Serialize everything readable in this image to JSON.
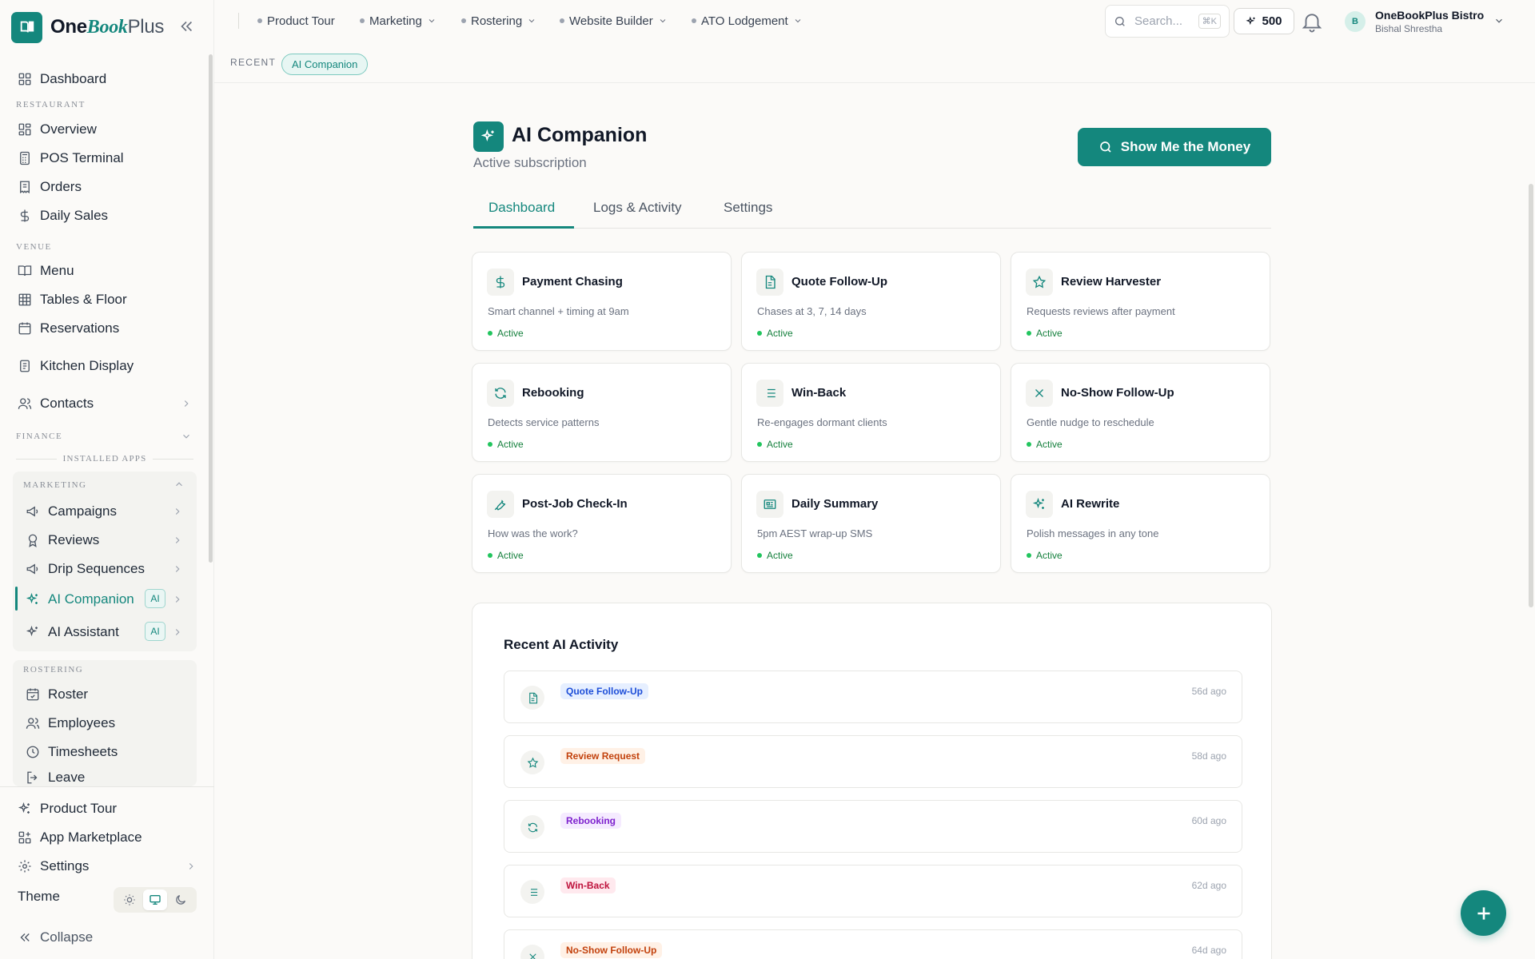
{
  "brand": {
    "name_1": "One",
    "name_2": "Book",
    "name_3": "Plus",
    "collapse_icon": "double-chevron-left-icon"
  },
  "sidebar": {
    "dashboard": "Dashboard",
    "restaurant_label": "RESTAURANT",
    "restaurant": [
      "Overview",
      "POS Terminal",
      "Orders",
      "Daily Sales"
    ],
    "venue_label": "VENUE",
    "venue": [
      "Menu",
      "Tables & Floor",
      "Reservations"
    ],
    "kitchen": "Kitchen Display",
    "contacts": "Contacts",
    "finance_label": "FINANCE",
    "installed_label": "INSTALLED APPS",
    "marketing_label": "MARKETING",
    "marketing": [
      "Campaigns",
      "Reviews",
      "Drip Sequences",
      "AI Companion",
      "AI Assistant"
    ],
    "ai_badge": "AI",
    "rostering_label": "ROSTERING",
    "rostering": [
      "Roster",
      "Employees",
      "Timesheets",
      "Leave"
    ],
    "product_tour": "Product Tour",
    "marketplace": "App Marketplace",
    "settings": "Settings",
    "theme": "Theme",
    "collapse": "Collapse"
  },
  "topbar": {
    "nav": [
      "Product Tour",
      "Marketing",
      "Rostering",
      "Website Builder",
      "ATO Lodgement"
    ],
    "search_placeholder": "Search...",
    "search_shortcut": "⌘K",
    "credits": "500",
    "user_initial": "B",
    "user_name": "OneBookPlus Bistro",
    "user_sub": "Bishal Shrestha"
  },
  "recent": {
    "label": "RECENT",
    "chip": "AI Companion"
  },
  "page": {
    "title": "AI Companion",
    "subtitle": "Active subscription",
    "action_button": "Show Me the Money",
    "tabs": [
      "Dashboard",
      "Logs & Activity",
      "Settings"
    ]
  },
  "cards": [
    {
      "title": "Payment Chasing",
      "desc": "Smart channel + timing at 9am",
      "status": "Active",
      "icon": "dollar-icon"
    },
    {
      "title": "Quote Follow-Up",
      "desc": "Chases at 3, 7, 14 days",
      "status": "Active",
      "icon": "document-icon"
    },
    {
      "title": "Review Harvester",
      "desc": "Requests reviews after payment",
      "status": "Active",
      "icon": "star-icon"
    },
    {
      "title": "Rebooking",
      "desc": "Detects service patterns",
      "status": "Active",
      "icon": "refresh-icon"
    },
    {
      "title": "Win-Back",
      "desc": "Re-engages dormant clients",
      "status": "Active",
      "icon": "list-icon"
    },
    {
      "title": "No-Show Follow-Up",
      "desc": "Gentle nudge to reschedule",
      "status": "Active",
      "icon": "x-icon"
    },
    {
      "title": "Post-Job Check-In",
      "desc": "How was the work?",
      "status": "Active",
      "icon": "wrench-icon"
    },
    {
      "title": "Daily Summary",
      "desc": "5pm AEST wrap-up SMS",
      "status": "Active",
      "icon": "newspaper-icon"
    },
    {
      "title": "AI Rewrite",
      "desc": "Polish messages in any tone",
      "status": "Active",
      "icon": "sparkles-icon"
    }
  ],
  "activity": {
    "title": "Recent AI Activity",
    "rows": [
      {
        "tag": "Quote Follow-Up",
        "ago": "56d ago",
        "tag_color": "#1d4ed8",
        "tag_bg": "#e6efff",
        "icon": "document-icon"
      },
      {
        "tag": "Review Request",
        "ago": "58d ago",
        "tag_color": "#c2410c",
        "tag_bg": "#fff1e6",
        "icon": "star-icon"
      },
      {
        "tag": "Rebooking",
        "ago": "60d ago",
        "tag_color": "#7e22ce",
        "tag_bg": "#f5ebff",
        "icon": "refresh-icon"
      },
      {
        "tag": "Win-Back",
        "ago": "62d ago",
        "tag_color": "#be123c",
        "tag_bg": "#ffe9ee",
        "icon": "list-icon"
      },
      {
        "tag": "No-Show Follow-Up",
        "ago": "64d ago",
        "tag_color": "#c2410c",
        "tag_bg": "#fff1e6",
        "icon": "x-icon"
      }
    ]
  },
  "colors": {
    "accent": "#14877d",
    "active_green": "#22c55e"
  }
}
